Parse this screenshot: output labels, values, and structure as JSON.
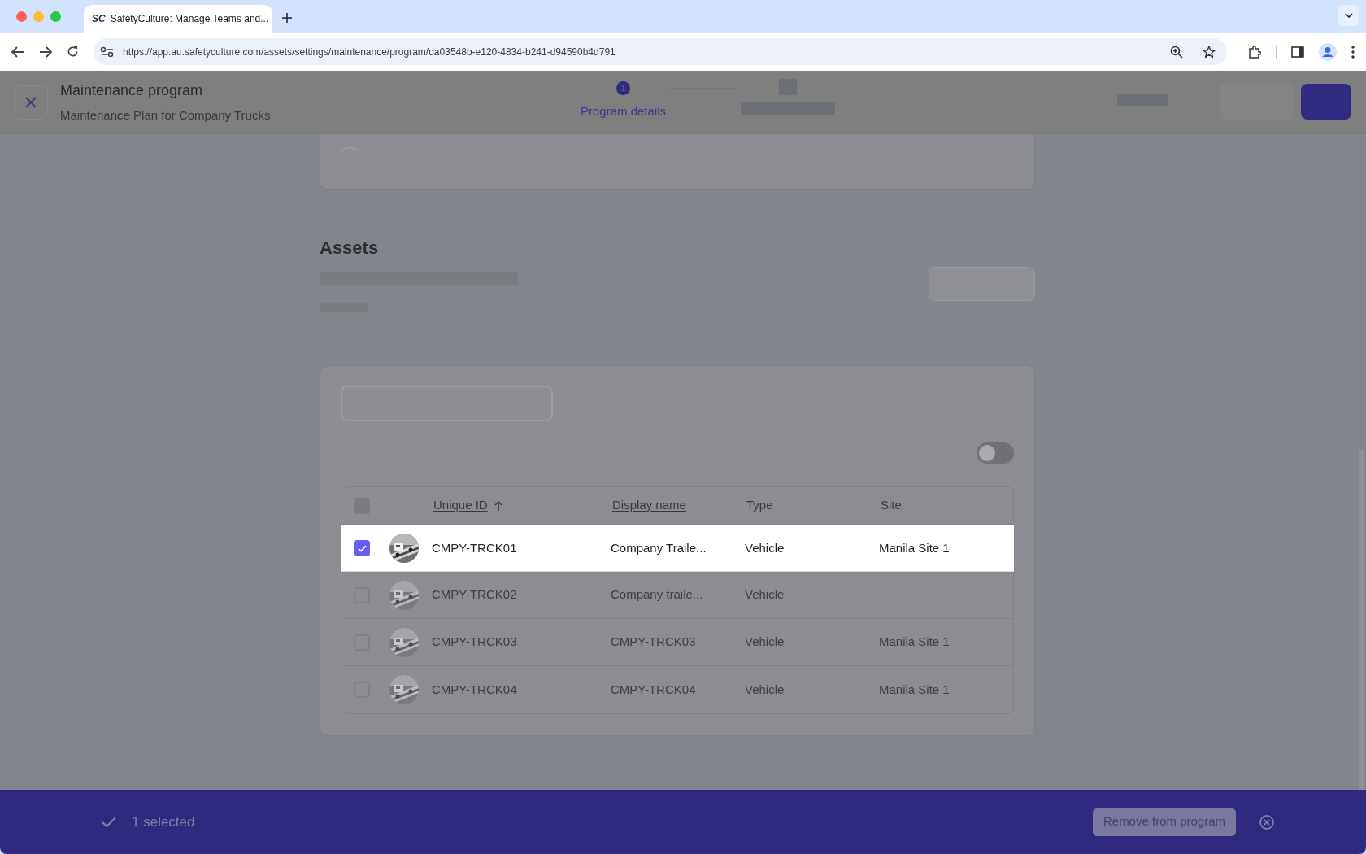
{
  "browser": {
    "tab_title": "SafetyCulture: Manage Teams and...",
    "favicon_text": "SC",
    "url": "https://app.au.safetyculture.com/assets/settings/maintenance/program/da03548b-e120-4834-b241-d94590b4d791"
  },
  "header": {
    "title": "Maintenance program",
    "subtitle": "Maintenance Plan for Company Trucks",
    "steps": [
      {
        "number": "1",
        "label": "Program details",
        "selected": true
      },
      {
        "selected": false
      }
    ]
  },
  "assets": {
    "heading": "Assets",
    "show_archived": {
      "on": false
    },
    "select_all": {
      "checked": false
    },
    "columns": [
      {
        "label": "Unique ID",
        "sortable": true,
        "sorted": true
      },
      {
        "label": "Display name",
        "sortable": true,
        "sorted": false
      },
      {
        "label": "Type",
        "sortable": false,
        "sorted": false
      },
      {
        "label": "Site",
        "sortable": false,
        "sorted": false
      }
    ],
    "rows": [
      {
        "id": "CMPY-TRCK01",
        "display_name": "Company Traile...",
        "type": "Vehicle",
        "site": "Manila Site 1",
        "selected": true
      },
      {
        "id": "CMPY-TRCK02",
        "display_name": "Company traile...",
        "type": "Vehicle",
        "selected": false
      },
      {
        "id": "CMPY-TRCK03",
        "display_name": "CMPY-TRCK03",
        "type": "Vehicle",
        "site": "Manila Site 1",
        "selected": false
      },
      {
        "id": "CMPY-TRCK04",
        "display_name": "CMPY-TRCK04",
        "type": "Vehicle",
        "site": "Manila Site 1",
        "selected": false
      }
    ]
  },
  "selection_bar": {
    "count_label": "1 selected",
    "action": "Remove from program"
  }
}
